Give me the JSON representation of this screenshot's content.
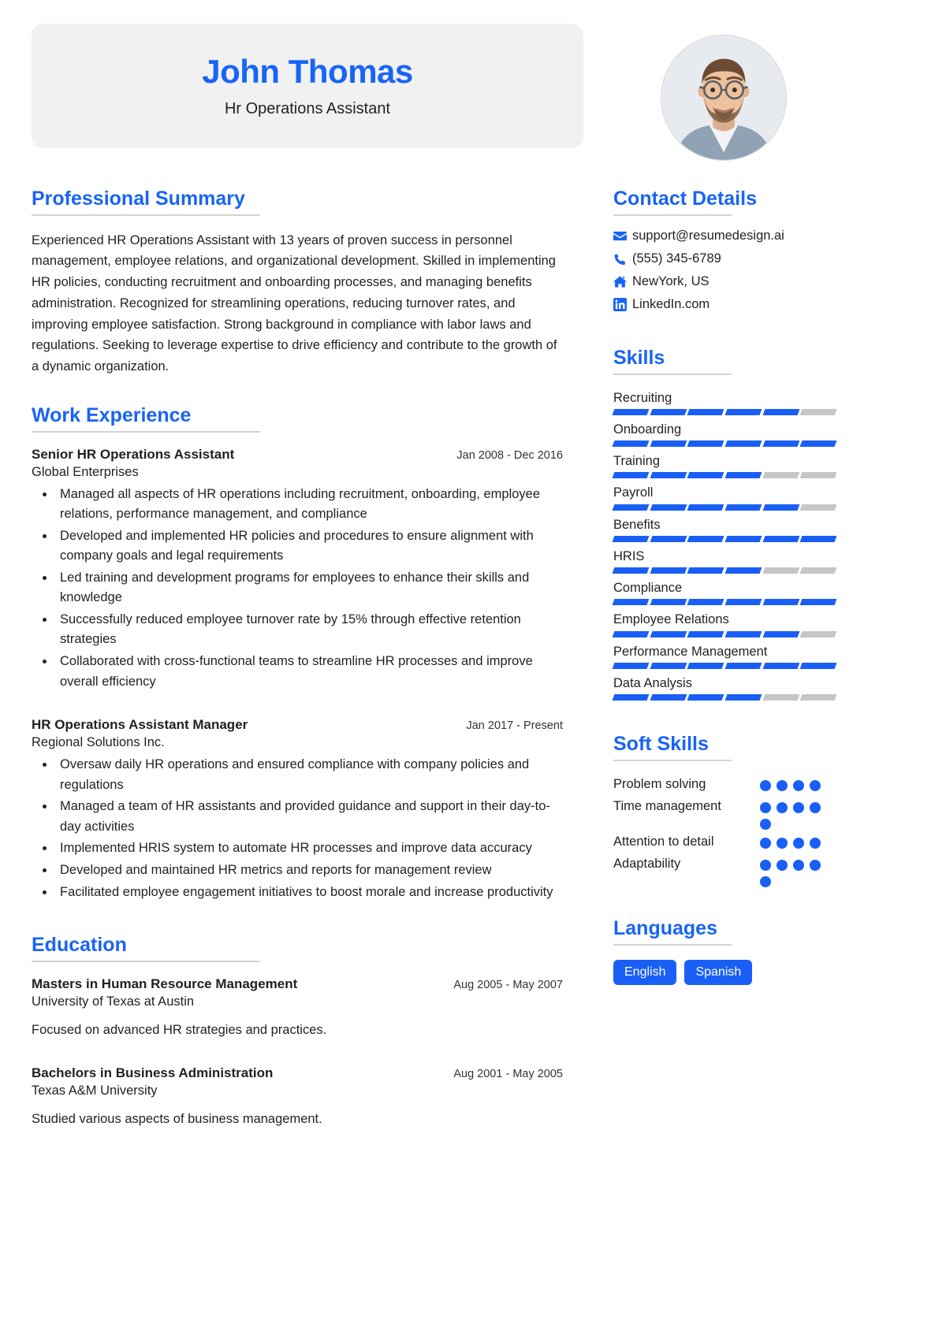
{
  "header": {
    "name": "John Thomas",
    "job_title": "Hr Operations Assistant",
    "avatar_alt": "profile-photo"
  },
  "theme": {
    "accent": "#1864f5",
    "bar_on": "#1a5ff5",
    "bar_off": "#c6c6c6",
    "band_bg": "#f1f1f1",
    "text": "#231f20"
  },
  "summary": {
    "title": "Professional Summary",
    "text": "Experienced HR Operations Assistant with 13 years of proven success in personnel management, employee relations, and organizational development. Skilled in implementing HR policies, conducting recruitment and onboarding processes, and managing benefits administration. Recognized for streamlining operations, reducing turnover rates, and improving employee satisfaction. Strong background in compliance with labor laws and regulations. Seeking to leverage expertise to drive efficiency and contribute to the growth of a dynamic organization."
  },
  "work": {
    "title": "Work Experience",
    "entries": [
      {
        "role": "Senior HR Operations Assistant",
        "org": "Global Enterprises",
        "date": "Jan 2008 - Dec 2016",
        "bullets": [
          "Managed all aspects of HR operations including recruitment, onboarding, employee relations, performance management, and compliance",
          "Developed and implemented HR policies and procedures to ensure alignment with company goals and legal requirements",
          "Led training and development programs for employees to enhance their skills and knowledge",
          "Successfully reduced employee turnover rate by 15% through effective retention strategies",
          "Collaborated with cross-functional teams to streamline HR processes and improve overall efficiency"
        ]
      },
      {
        "role": "HR Operations Assistant Manager",
        "org": "Regional Solutions Inc.",
        "date": "Jan 2017 - Present",
        "bullets": [
          "Oversaw daily HR operations and ensured compliance with company policies and regulations",
          "Managed a team of HR assistants and provided guidance and support in their day-to-day activities",
          "Implemented HRIS system to automate HR processes and improve data accuracy",
          "Developed and maintained HR metrics and reports for management review",
          "Facilitated employee engagement initiatives to boost morale and increase productivity"
        ]
      }
    ]
  },
  "education": {
    "title": "Education",
    "entries": [
      {
        "degree": "Masters in Human Resource Management",
        "school": "University of Texas at Austin",
        "date": "Aug 2005 - May 2007",
        "desc": "Focused on advanced HR strategies and practices."
      },
      {
        "degree": "Bachelors in Business Administration",
        "school": "Texas A&M University",
        "date": "Aug 2001 - May 2005",
        "desc": "Studied various aspects of business management."
      }
    ]
  },
  "contact": {
    "title": "Contact Details",
    "items": [
      {
        "icon": "envelope-icon",
        "value": "support@resumedesign.ai"
      },
      {
        "icon": "phone-icon",
        "value": "(555) 345-6789"
      },
      {
        "icon": "home-icon",
        "value": "NewYork, US"
      },
      {
        "icon": "linkedin-icon",
        "value": "LinkedIn.com"
      }
    ]
  },
  "skills": {
    "title": "Skills",
    "segments_total": 6,
    "items": [
      {
        "name": "Recruiting",
        "filled": 5
      },
      {
        "name": "Onboarding",
        "filled": 6
      },
      {
        "name": "Training",
        "filled": 4
      },
      {
        "name": "Payroll",
        "filled": 5
      },
      {
        "name": "Benefits",
        "filled": 6
      },
      {
        "name": "HRIS",
        "filled": 4
      },
      {
        "name": "Compliance",
        "filled": 6
      },
      {
        "name": "Employee Relations",
        "filled": 5
      },
      {
        "name": "Performance Management",
        "filled": 6
      },
      {
        "name": "Data Analysis",
        "filled": 4
      }
    ]
  },
  "soft_skills": {
    "title": "Soft Skills",
    "dots_total": 4,
    "items": [
      {
        "name": "Problem solving",
        "filled": 4
      },
      {
        "name": "Time management",
        "filled": 5
      },
      {
        "name": "Attention to detail",
        "filled": 4
      },
      {
        "name": "Adaptability",
        "filled": 5
      }
    ]
  },
  "languages": {
    "title": "Languages",
    "items": [
      "English",
      "Spanish"
    ]
  }
}
